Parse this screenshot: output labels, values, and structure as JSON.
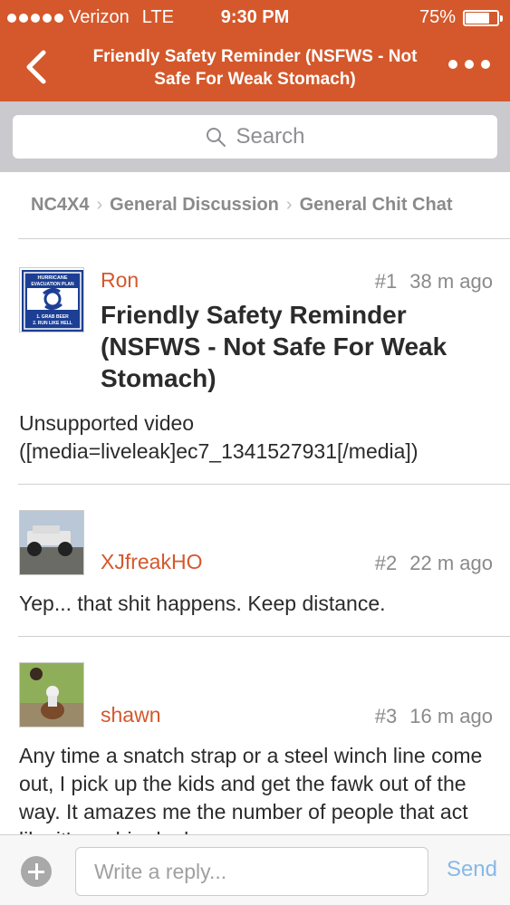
{
  "status_bar": {
    "carrier": "Verizon",
    "network": "LTE",
    "time": "9:30 PM",
    "battery": "75%",
    "battery_level": 0.75
  },
  "header": {
    "title": "Friendly Safety Reminder (NSFWS - Not Safe For Weak Stomach)",
    "back_icon": "chevron-left-icon",
    "more_icon": "more-dots-icon",
    "color": "#d4582b"
  },
  "search": {
    "placeholder": "Search",
    "icon": "search-icon"
  },
  "breadcrumb": [
    {
      "label": "NC4X4"
    },
    {
      "label": "General Discussion"
    },
    {
      "label": "General Chit Chat"
    }
  ],
  "posts": [
    {
      "author": "Ron",
      "number": "#1",
      "time": "38 m ago",
      "title": "Friendly Safety Reminder (NSFWS - Not Safe For Weak Stomach)",
      "body": "Unsupported video ([media=liveleak]ec7_1341527931[/media])",
      "avatar_lines": [
        "HURRICANE",
        "EVACUATION PLAN",
        "1. GRAB BEER",
        "2. RUN LIKE HELL"
      ]
    },
    {
      "author": "XJfreakHO",
      "number": "#2",
      "time": "22 m ago",
      "body": "Yep...  that shit happens.  Keep distance."
    },
    {
      "author": "shawn",
      "number": "#3",
      "time": "16 m ago",
      "body": "Any time a snatch strap or a steel winch line come out, I pick up the kids and get the fawk out of the way. It amazes me the number of people that act like it's no big deal."
    }
  ],
  "reply": {
    "placeholder": "Write a reply...",
    "send_label": "Send",
    "add_icon": "plus-circle-icon"
  },
  "colors": {
    "accent": "#d4582b",
    "send": "#87b9e6",
    "muted": "#8a8a8a"
  }
}
